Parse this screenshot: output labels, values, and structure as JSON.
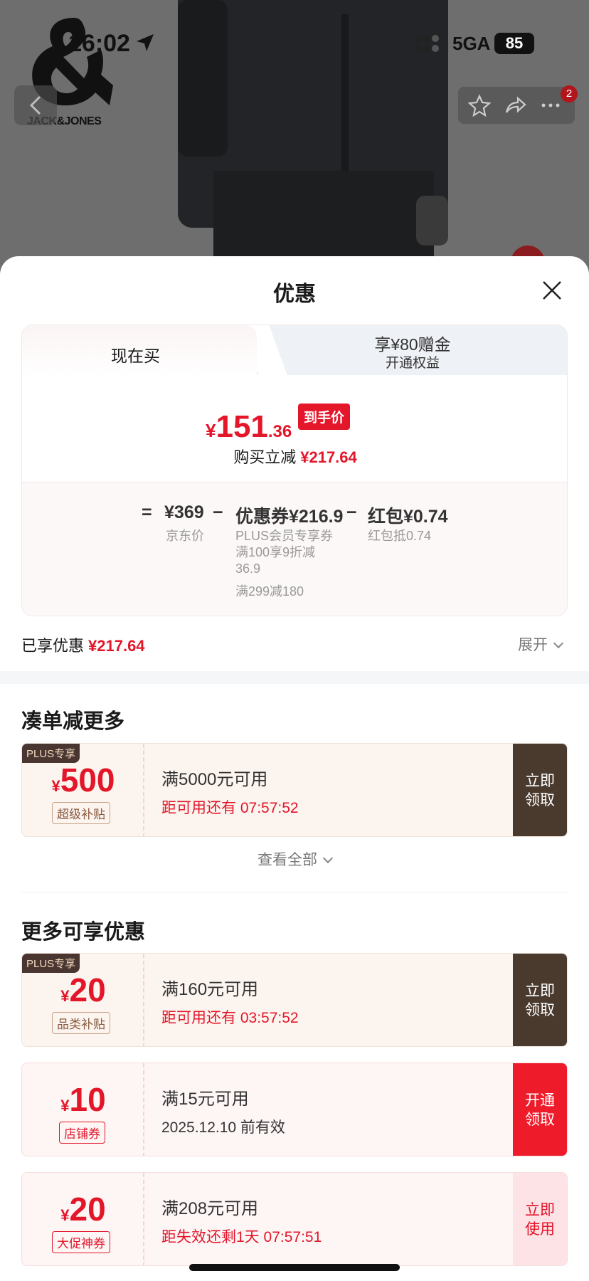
{
  "status_bar": {
    "time": "16:02",
    "network": "5GA",
    "battery": "85"
  },
  "brand": {
    "logo_text": "JACK&JONES"
  },
  "top_actions": {
    "badge_count": "2"
  },
  "sheet": {
    "title": "优惠",
    "tabs": {
      "buy_now": "现在买",
      "gold_line1": "享¥80赠金",
      "gold_line2": "开通权益"
    },
    "price": {
      "yen": "¥",
      "int": "151",
      "dec": ".36",
      "tag": "到手价"
    },
    "instant_cut": {
      "label": "购买立减",
      "value": "¥217.64"
    },
    "breakdown": {
      "eq": "=",
      "jd_price": "¥369",
      "jd_label": "京东价",
      "minus1": "−",
      "coupon": "优惠券¥216.9",
      "coupon_note1": "PLUS会员专享券",
      "coupon_note2": "满100享9折减",
      "coupon_note3": "36.9",
      "coupon_note4": "满299减180",
      "minus2": "−",
      "redpack": "红包¥0.74",
      "redpack_note": "红包抵0.74"
    },
    "enjoyed": {
      "label": "已享优惠",
      "value": "¥217.64"
    },
    "expand_label": "展开"
  },
  "section1": {
    "title": "凑单减更多",
    "coupon": {
      "plus": "PLUS专享",
      "yen": "¥",
      "amount": "500",
      "tag": "超级补贴",
      "condition": "满5000元可用",
      "sub": "距可用还有 07:57:52",
      "btn": "立即领取"
    },
    "see_all": "查看全部"
  },
  "section2": {
    "title": "更多可享优惠",
    "coupons": [
      {
        "plus": "PLUS专享",
        "yen": "¥",
        "amount": "20",
        "tag": "品类补贴",
        "condition": "满160元可用",
        "sub": "距可用还有 03:57:52",
        "btn": "立即领取"
      },
      {
        "yen": "¥",
        "amount": "10",
        "tag": "店铺券",
        "condition": "满15元可用",
        "sub": "2025.12.10 前有效",
        "btn": "开通领取"
      },
      {
        "yen": "¥",
        "amount": "20",
        "tag": "大促神券",
        "condition": "满208元可用",
        "sub": "距失效还剩1天 07:57:51",
        "btn": "立即使用"
      }
    ]
  },
  "colors": {
    "accent_red": "#e3162a",
    "brown": "#4a3a2e"
  }
}
